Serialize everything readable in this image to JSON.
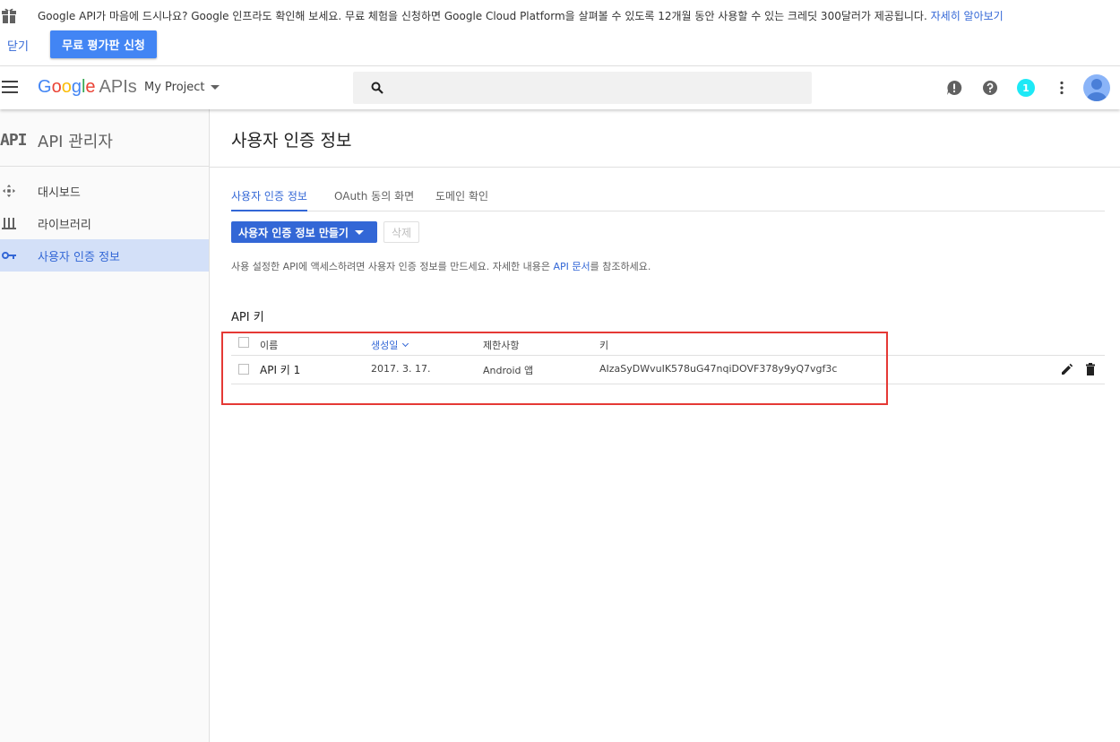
{
  "banner": {
    "message": "Google API가 마음에 드시나요? Google 인프라도 확인해 보세요. 무료 체험을 신청하면 Google Cloud Platform을 살펴볼 수 있도록 12개월 동안 사용할 수 있는 크레딧 300달러가 제공됩니다.",
    "learn_more": "자세히 알아보기",
    "close_label": "닫기",
    "trial_button": "무료 평가판 신청"
  },
  "header": {
    "logo_letters": [
      "G",
      "o",
      "o",
      "g",
      "l",
      "e"
    ],
    "logo_suffix": "APIs",
    "project": "My Project",
    "notification_count": "1",
    "icons": [
      "menu-icon",
      "search-icon",
      "feedback-icon",
      "help-icon",
      "more-vert-icon",
      "avatar"
    ]
  },
  "sidebar": {
    "logo_text": "API",
    "title": "API 관리자",
    "items": [
      {
        "label": "대시보드",
        "icon": "dashboard-icon",
        "active": false
      },
      {
        "label": "라이브러리",
        "icon": "library-icon",
        "active": false
      },
      {
        "label": "사용자 인증 정보",
        "icon": "key-icon",
        "active": true
      }
    ]
  },
  "main": {
    "title": "사용자 인증 정보",
    "tabs": [
      {
        "label": "사용자 인증 정보",
        "active": true
      },
      {
        "label": "OAuth 동의 화면",
        "active": false
      },
      {
        "label": "도메인 확인",
        "active": false
      }
    ],
    "create_button": "사용자 인증 정보 만들기",
    "delete_button": "삭제",
    "description_prefix": "사용 설정한 API에 액세스하려면 사용자 인증 정보를 만드세요. 자세한 내용은 ",
    "description_link": "API 문서",
    "description_suffix": "를 참조하세요.",
    "section_title": "API 키",
    "table": {
      "columns": [
        "이름",
        "생성일",
        "제한사항",
        "키"
      ],
      "sorted_column": "생성일",
      "rows": [
        {
          "name": "API 키 1",
          "created": "2017. 3. 17.",
          "restriction": "Android 앱",
          "key": "AIzaSyDWvuIK578uG47nqiDOVF378y9yQ7vgf3c"
        }
      ]
    }
  },
  "colors": {
    "accent": "#3367d6",
    "highlight_box": "#e53935",
    "active_nav_bg": "#d3e0f8"
  }
}
